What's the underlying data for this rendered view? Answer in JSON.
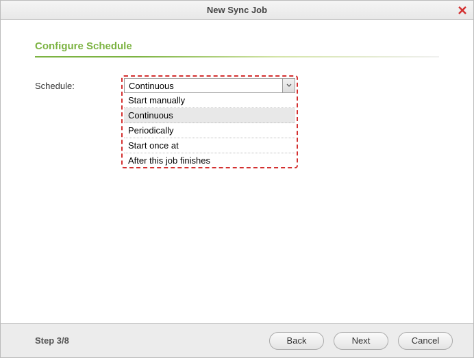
{
  "title": "New Sync Job",
  "section_title": "Configure Schedule",
  "form": {
    "schedule_label": "Schedule:",
    "schedule_value": "Continuous",
    "options": {
      "0": "Start manually",
      "1": "Continuous",
      "2": "Periodically",
      "3": "Start once at",
      "4": "After this job finishes"
    }
  },
  "footer": {
    "step": "Step 3/8",
    "back": "Back",
    "next": "Next",
    "cancel": "Cancel"
  }
}
